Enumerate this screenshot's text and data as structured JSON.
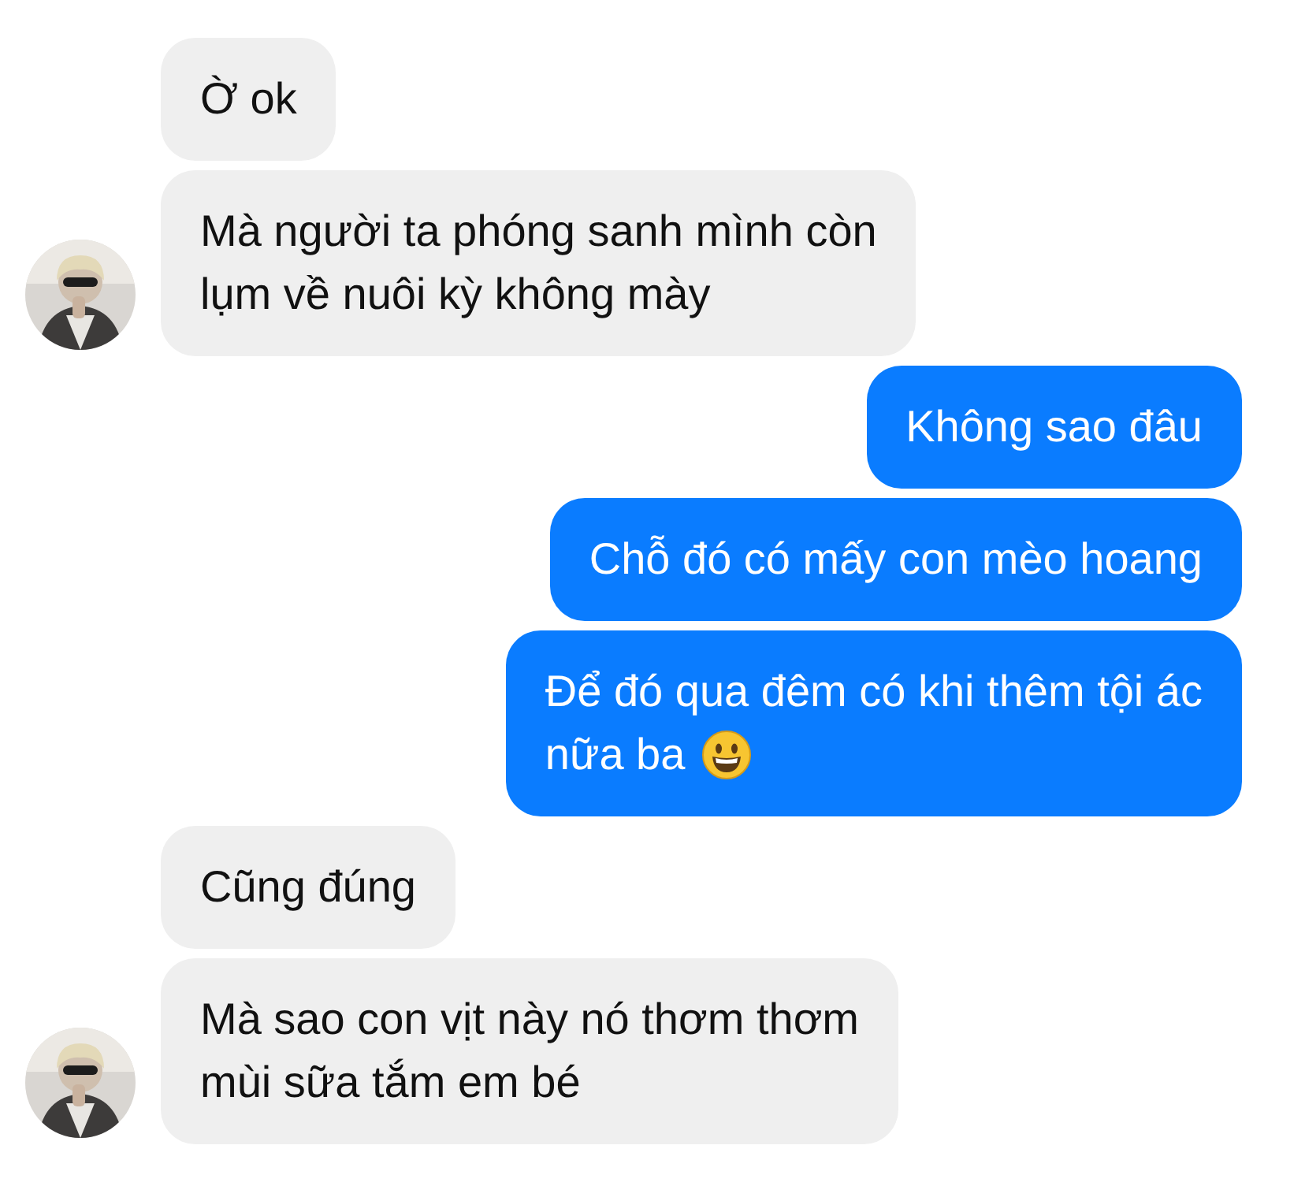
{
  "messages": [
    {
      "kind": "incoming",
      "lines": [
        "Ờ ok"
      ],
      "avatar": false
    },
    {
      "kind": "incoming",
      "lines": [
        "Mà người ta phóng sanh mình còn",
        "lụm về nuôi kỳ không mày"
      ],
      "avatar": true
    },
    {
      "kind": "outgoing",
      "lines": [
        "Không sao đâu"
      ],
      "avatar": false
    },
    {
      "kind": "outgoing",
      "lines": [
        "Chỗ đó có mấy con mèo hoang"
      ],
      "avatar": false
    },
    {
      "kind": "outgoing",
      "lines": [
        "Để đó qua đêm có khi thêm tội ác",
        "nữa ba"
      ],
      "emoji": true,
      "avatar": false
    },
    {
      "kind": "incoming",
      "lines": [
        "Cũng đúng"
      ],
      "avatar": false
    },
    {
      "kind": "incoming",
      "lines": [
        "Mà sao con vịt này nó thơm thơm",
        "mùi sữa tắm em bé"
      ],
      "avatar": true
    }
  ]
}
